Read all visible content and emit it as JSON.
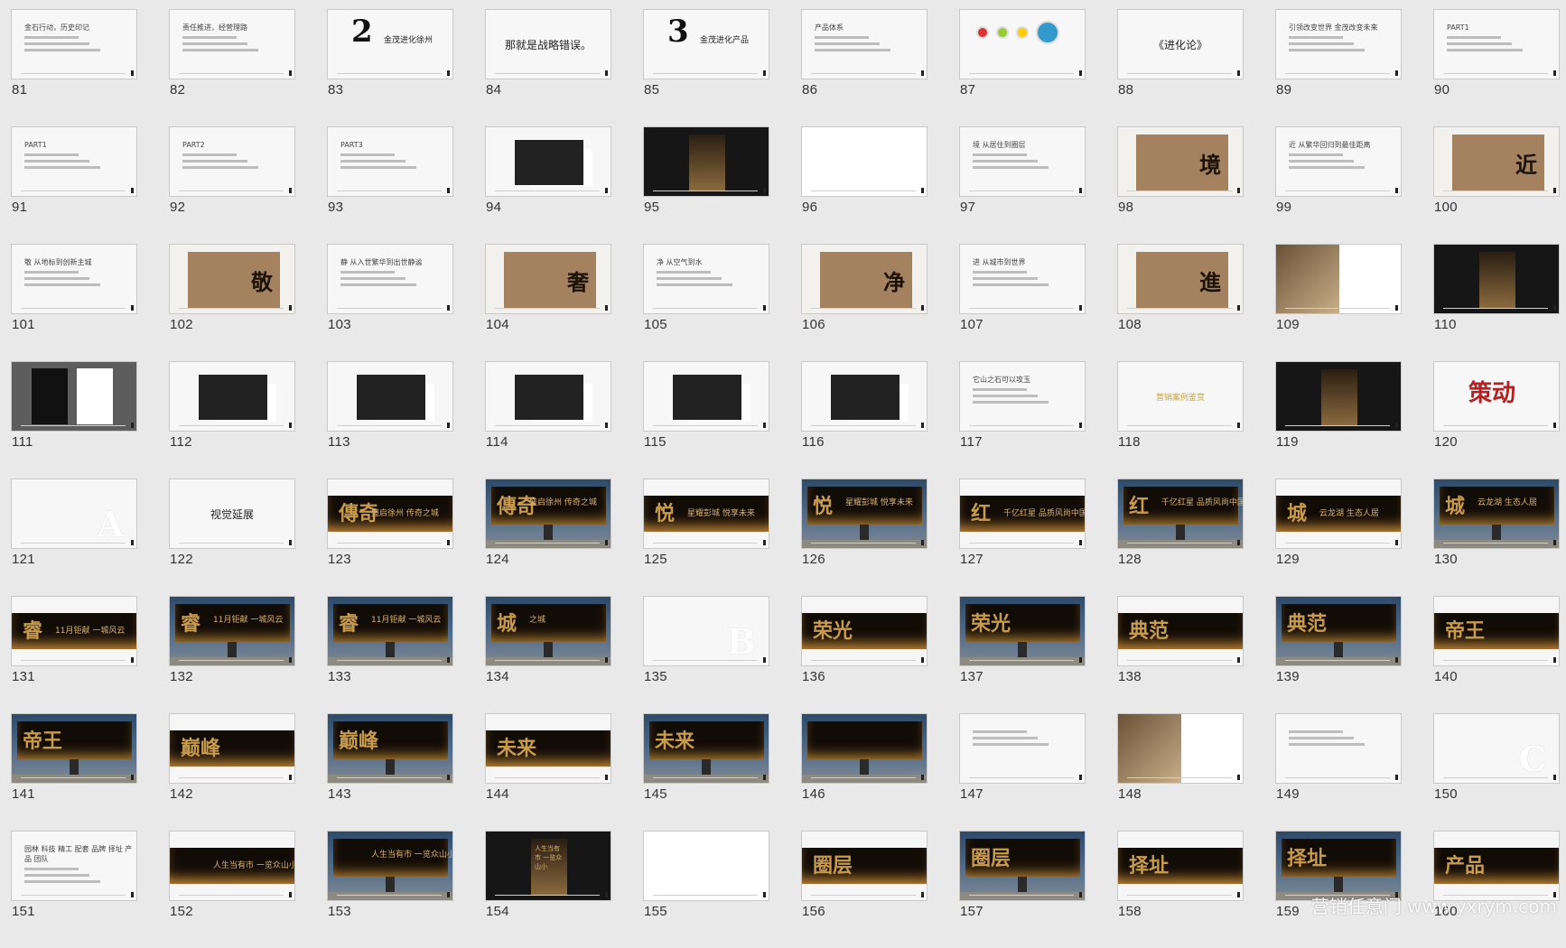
{
  "watermark": "营销任意门 www.yxrym.com",
  "slides": [
    {
      "n": "81",
      "v": "text",
      "text": "金石行动，历史印记"
    },
    {
      "n": "82",
      "v": "text",
      "text": "责任推进，经营理路"
    },
    {
      "n": "83",
      "v": "center",
      "glyph": "2",
      "text": "金茂进化徐州"
    },
    {
      "n": "84",
      "v": "center",
      "glyph": "",
      "text": "那就是战略错误。"
    },
    {
      "n": "85",
      "v": "center",
      "glyph": "3",
      "text": "金茂进化产品"
    },
    {
      "n": "86",
      "v": "text",
      "text": "产品体系"
    },
    {
      "n": "87",
      "v": "dots",
      "text": ""
    },
    {
      "n": "88",
      "v": "center",
      "glyph": "",
      "text": "《进化论》"
    },
    {
      "n": "89",
      "v": "text",
      "text": "引领改变世界 金茂改变未来"
    },
    {
      "n": "90",
      "v": "text",
      "text": "PART1"
    },
    {
      "n": "91",
      "v": "text",
      "text": "PART1"
    },
    {
      "n": "92",
      "v": "text",
      "text": "PART2"
    },
    {
      "n": "93",
      "v": "text",
      "text": "PART3"
    },
    {
      "n": "94",
      "v": "light",
      "text": ""
    },
    {
      "n": "95",
      "v": "dark",
      "glyph": "",
      "text": ""
    },
    {
      "n": "96",
      "v": "white",
      "text": ""
    },
    {
      "n": "97",
      "v": "text",
      "text": "境 从居住到圈层"
    },
    {
      "n": "98",
      "v": "brown",
      "glyph": "境"
    },
    {
      "n": "99",
      "v": "text",
      "text": "近 从繁华回归到最佳距离"
    },
    {
      "n": "100",
      "v": "brown",
      "glyph": "近"
    },
    {
      "n": "101",
      "v": "text",
      "text": "敬 从地标到创新主城"
    },
    {
      "n": "102",
      "v": "brown",
      "glyph": "敬"
    },
    {
      "n": "103",
      "v": "text",
      "text": "静 从入世繁华到出世静谧"
    },
    {
      "n": "104",
      "v": "brown",
      "glyph": "奢"
    },
    {
      "n": "105",
      "v": "text",
      "text": "净 从空气到水"
    },
    {
      "n": "106",
      "v": "brown",
      "glyph": "净"
    },
    {
      "n": "107",
      "v": "text",
      "text": "进 从城市到世界"
    },
    {
      "n": "108",
      "v": "brown",
      "glyph": "進"
    },
    {
      "n": "109",
      "v": "photo",
      "text": ""
    },
    {
      "n": "110",
      "v": "dark",
      "glyph": "",
      "text": ""
    },
    {
      "n": "111",
      "v": "grey",
      "text": ""
    },
    {
      "n": "112",
      "v": "light",
      "text": ""
    },
    {
      "n": "113",
      "v": "light",
      "text": ""
    },
    {
      "n": "114",
      "v": "light",
      "text": ""
    },
    {
      "n": "115",
      "v": "product",
      "text": ""
    },
    {
      "n": "116",
      "v": "product",
      "text": ""
    },
    {
      "n": "117",
      "v": "text",
      "text": "它山之石可以攻玉"
    },
    {
      "n": "118",
      "v": "yellow",
      "text": "营销案例鉴赏"
    },
    {
      "n": "119",
      "v": "dark",
      "glyph": "",
      "text": ""
    },
    {
      "n": "120",
      "v": "redbig",
      "text": "策动"
    },
    {
      "n": "121",
      "v": "letter",
      "text": "A"
    },
    {
      "n": "122",
      "v": "center",
      "glyph": "",
      "text": "视觉延展"
    },
    {
      "n": "123",
      "v": "banner",
      "glyph": "傳奇",
      "text": "盛启徐州 传奇之城"
    },
    {
      "n": "124",
      "v": "billboard",
      "glyph": "傳奇",
      "text": "盛启徐州 传奇之城"
    },
    {
      "n": "125",
      "v": "banner",
      "glyph": "悦",
      "text": "星耀彭城 悦享未来"
    },
    {
      "n": "126",
      "v": "billboard",
      "glyph": "悦",
      "text": "星耀彭城 悦享未来"
    },
    {
      "n": "127",
      "v": "banner",
      "glyph": "红",
      "text": "千亿红星 品质风尚中国"
    },
    {
      "n": "128",
      "v": "billboard",
      "glyph": "红",
      "text": "千亿红星 品质风尚中国"
    },
    {
      "n": "129",
      "v": "banner",
      "glyph": "城",
      "text": "云龙湖 生态人居"
    },
    {
      "n": "130",
      "v": "billboard",
      "glyph": "城",
      "text": "云龙湖 生态人居"
    },
    {
      "n": "131",
      "v": "banner",
      "glyph": "睿",
      "text": "11月钜献 一城风云"
    },
    {
      "n": "132",
      "v": "billboard",
      "glyph": "睿",
      "text": "11月钜献 一城风云"
    },
    {
      "n": "133",
      "v": "billboard",
      "glyph": "睿",
      "text": "11月钜献 一城风云"
    },
    {
      "n": "134",
      "v": "billboard",
      "glyph": "城",
      "text": "之城"
    },
    {
      "n": "135",
      "v": "letter",
      "text": "B"
    },
    {
      "n": "136",
      "v": "banner",
      "glyph": "荣光",
      "text": ""
    },
    {
      "n": "137",
      "v": "billboard",
      "glyph": "荣光",
      "text": ""
    },
    {
      "n": "138",
      "v": "banner",
      "glyph": "典范",
      "text": ""
    },
    {
      "n": "139",
      "v": "billboard",
      "glyph": "典范",
      "text": ""
    },
    {
      "n": "140",
      "v": "banner",
      "glyph": "帝王",
      "text": ""
    },
    {
      "n": "141",
      "v": "billboard",
      "glyph": "帝王",
      "text": ""
    },
    {
      "n": "142",
      "v": "banner",
      "glyph": "巅峰",
      "text": ""
    },
    {
      "n": "143",
      "v": "billboard",
      "glyph": "巅峰",
      "text": ""
    },
    {
      "n": "144",
      "v": "banner",
      "glyph": "未来",
      "text": ""
    },
    {
      "n": "145",
      "v": "billboard",
      "glyph": "未来",
      "text": ""
    },
    {
      "n": "146",
      "v": "billboard",
      "glyph": "",
      "text": ""
    },
    {
      "n": "147",
      "v": "text",
      "text": ""
    },
    {
      "n": "148",
      "v": "photo",
      "text": ""
    },
    {
      "n": "149",
      "v": "text",
      "text": ""
    },
    {
      "n": "150",
      "v": "letter",
      "text": "C"
    },
    {
      "n": "151",
      "v": "text",
      "text": "园林 科技 精工 配套 品牌 择址 产品 团队"
    },
    {
      "n": "152",
      "v": "banner",
      "glyph": "",
      "text": "人生当有市 一览众山小"
    },
    {
      "n": "153",
      "v": "billboard",
      "glyph": "",
      "text": "人生当有市 一览众山小"
    },
    {
      "n": "154",
      "v": "dark",
      "glyph": "",
      "text": "人生当有市 一览众山小"
    },
    {
      "n": "155",
      "v": "white",
      "text": ""
    },
    {
      "n": "156",
      "v": "banner",
      "glyph": "圈层",
      "text": ""
    },
    {
      "n": "157",
      "v": "billboard",
      "glyph": "圈层",
      "text": ""
    },
    {
      "n": "158",
      "v": "banner",
      "glyph": "择址",
      "text": ""
    },
    {
      "n": "159",
      "v": "billboard",
      "glyph": "择址",
      "text": ""
    },
    {
      "n": "160",
      "v": "banner",
      "glyph": "产品",
      "text": ""
    }
  ]
}
